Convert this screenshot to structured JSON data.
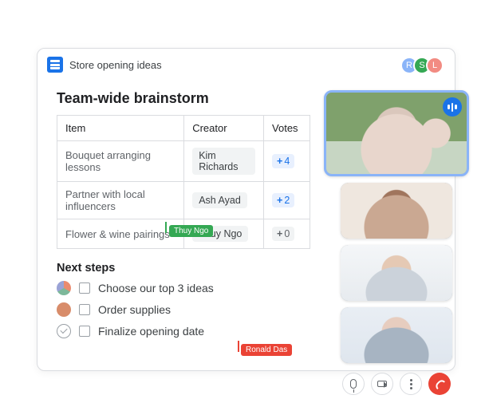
{
  "doc": {
    "title": "Store opening ideas"
  },
  "collaborators": [
    {
      "initial": "R",
      "color": "#8ab4f8"
    },
    {
      "initial": "S",
      "color": "#34a853"
    },
    {
      "initial": "L",
      "color": "#f28b82"
    }
  ],
  "heading": "Team-wide brainstorm",
  "table": {
    "columns": {
      "item": "Item",
      "creator": "Creator",
      "votes": "Votes"
    },
    "rows": [
      {
        "item": "Bouquet arranging lessons",
        "creator": "Kim Richards",
        "votes": "4",
        "active": true
      },
      {
        "item": "Partner with local influencers",
        "creator": "Ash Ayad",
        "votes": "2",
        "active": true
      },
      {
        "item": "Flower & wine pairings",
        "creator": "Thuy Ngo",
        "votes": "0",
        "active": false
      }
    ]
  },
  "cursor_tags": {
    "green": "Thuy Ngo",
    "red": "Ronald Das"
  },
  "next_steps": {
    "heading": "Next steps",
    "items": [
      {
        "text": "Choose our top 3 ideas",
        "icon": "group"
      },
      {
        "text": "Order supplies",
        "icon": "avatar"
      },
      {
        "text": "Finalize opening date",
        "icon": "check"
      }
    ]
  },
  "meet": {
    "participants": [
      "Speaker (active)",
      "Participant 2",
      "Participant 3",
      "Participant 4"
    ],
    "controls": [
      "mic",
      "camera",
      "more",
      "hangup"
    ]
  }
}
